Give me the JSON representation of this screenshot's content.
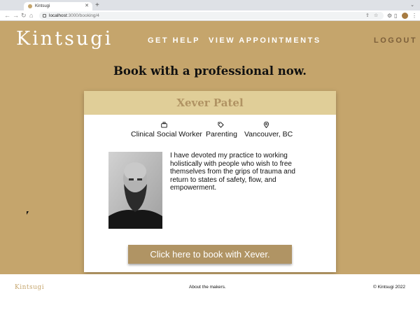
{
  "browser": {
    "tab_title": "Kintsugi",
    "tab_close": "✕",
    "new_tab": "+",
    "url_host": "localhost",
    "url_path": ":3000/booking/4"
  },
  "header": {
    "logo": "Kintsugi",
    "nav": [
      {
        "label": "GET HELP"
      },
      {
        "label": "VIEW APPOINTMENTS"
      }
    ],
    "logout": "LOGOUT"
  },
  "main": {
    "heading": "Book with a professional now."
  },
  "card": {
    "name": "Xever Patel",
    "meta": {
      "profession": "Clinical Social Worker",
      "specialty": "Parenting",
      "location": "Vancouver, BC"
    },
    "bio": "I have devoted my practice to working holistically with people who wish to free themselves from the grips of trauma and return to states of safety, flow, and empowerment.",
    "book_button": "Click here to book with Xever."
  },
  "footer": {
    "logo": "Kintsugi",
    "about": "About the makers.",
    "copyright": "© Kintsugi 2022"
  },
  "colors": {
    "page_bg": "#c5a56c",
    "card_header": "#e0ce98",
    "button": "#b09464",
    "name": "#b09363",
    "logout": "#7c5f3a"
  },
  "icons": {
    "profession": "briefcase-icon",
    "specialty": "tag-icon",
    "location": "map-pin-icon"
  }
}
